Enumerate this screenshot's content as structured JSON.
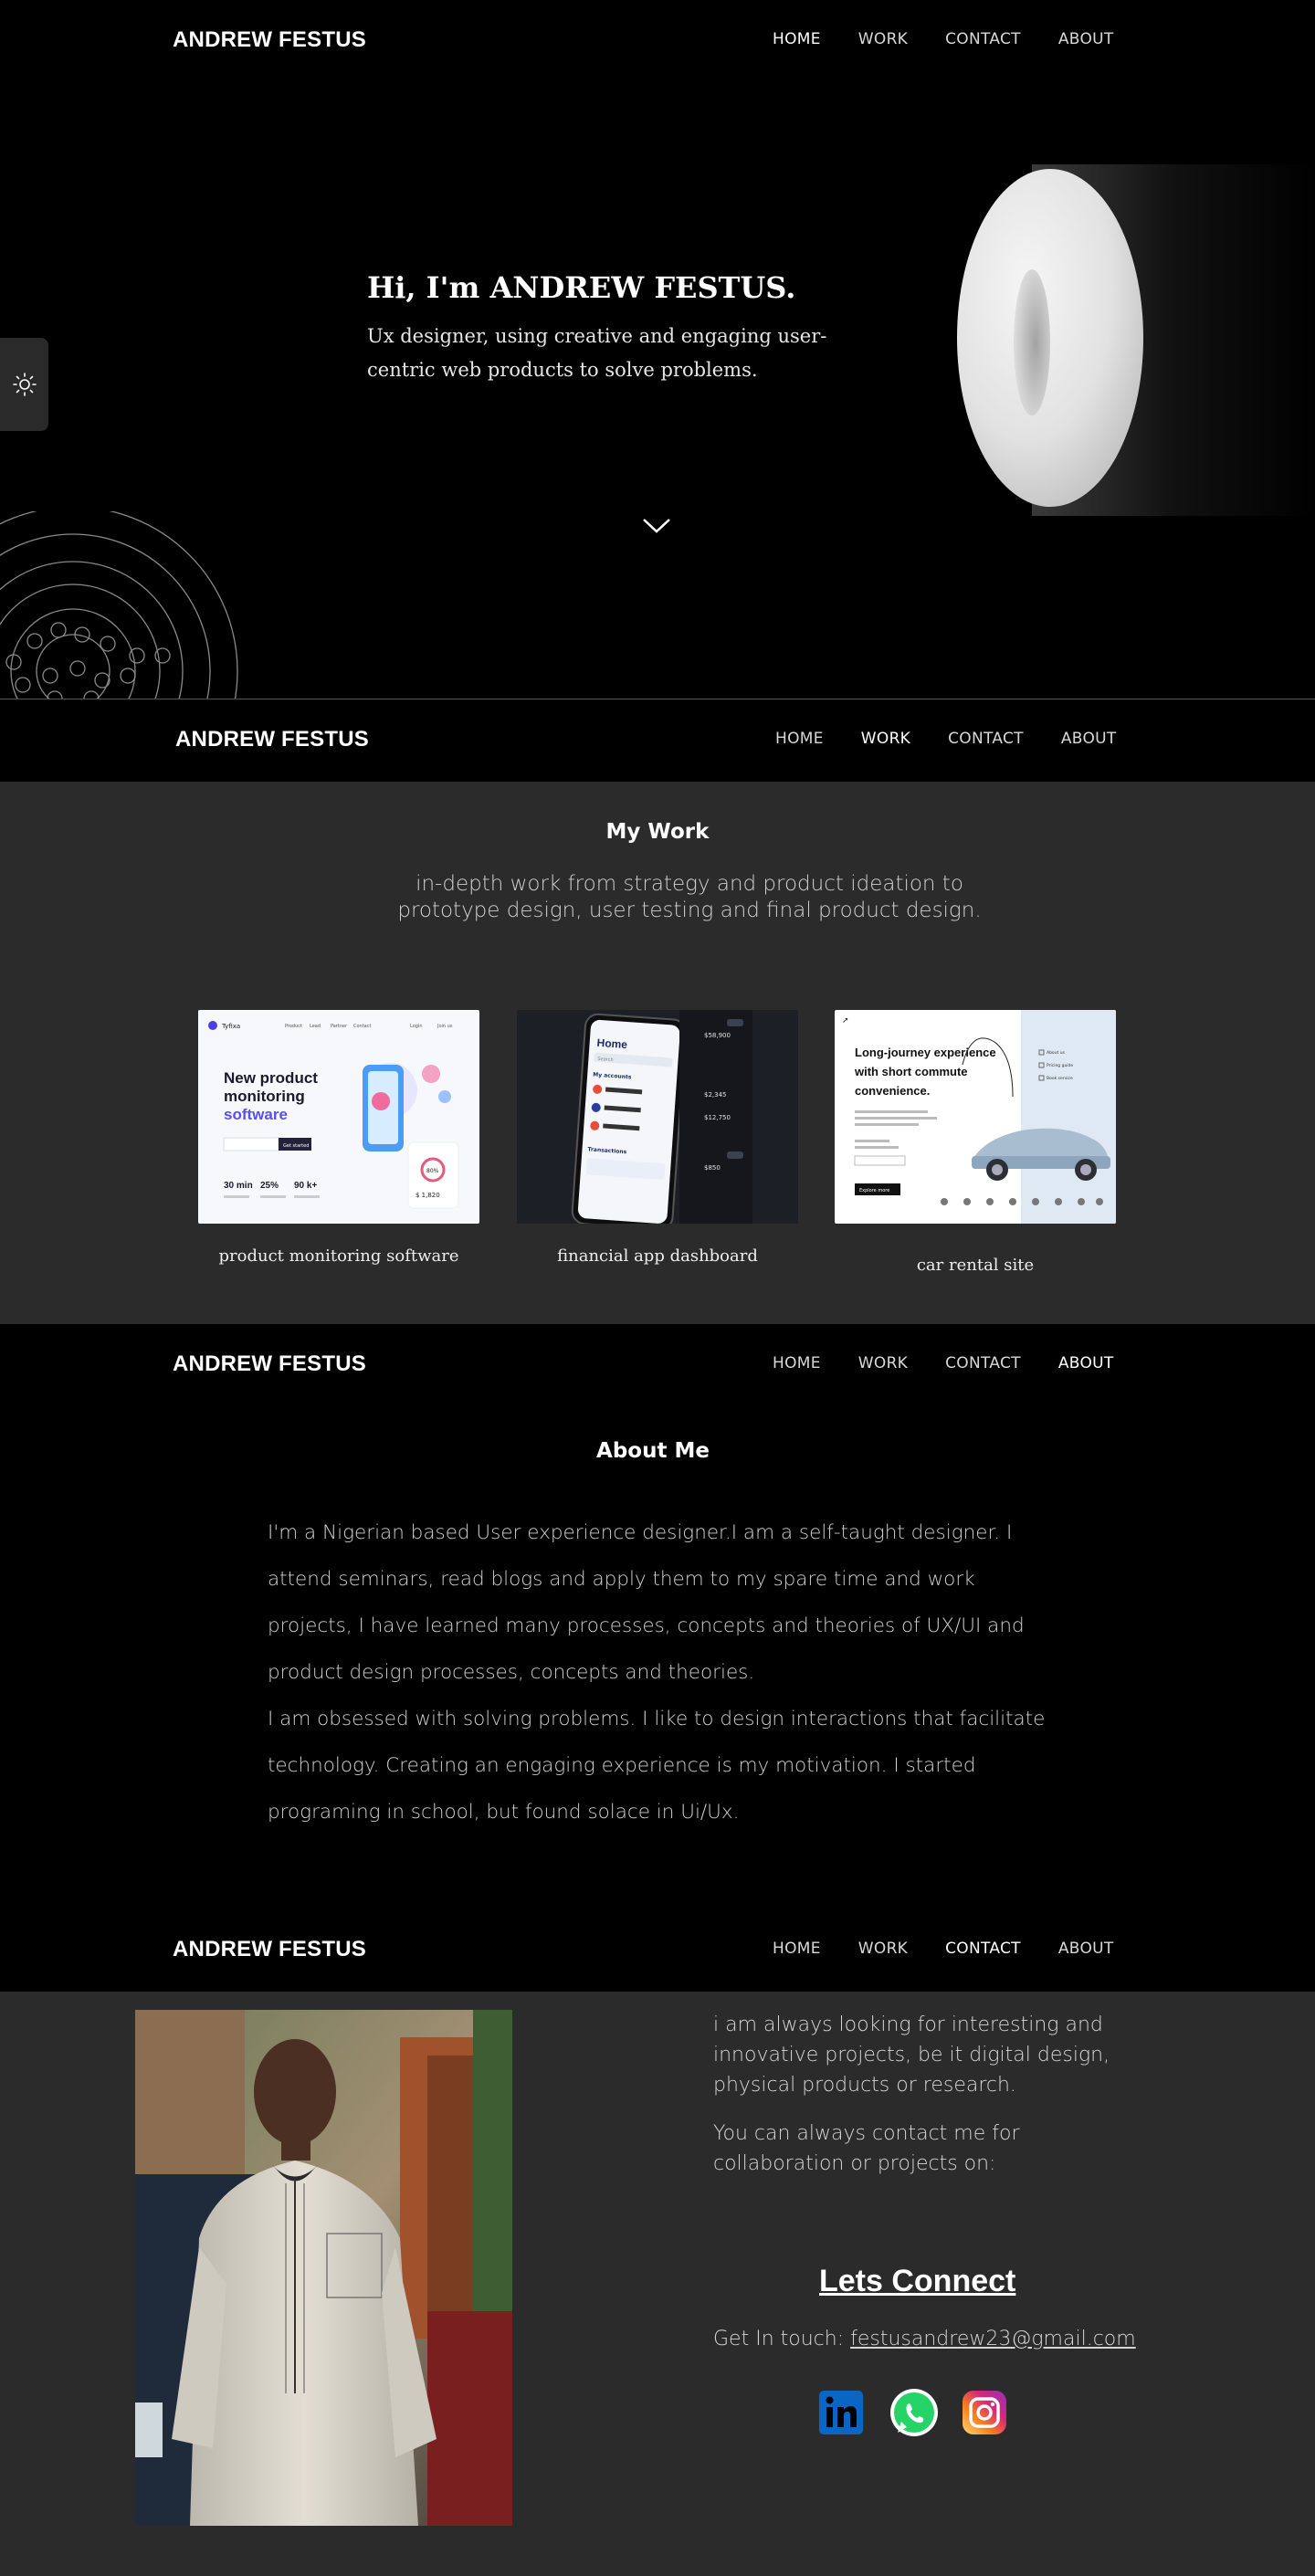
{
  "brand": "ANDREW FESTUS",
  "nav": [
    "HOME",
    "WORK",
    "CONTACT",
    "ABOUT"
  ],
  "hero": {
    "title": "Hi, I'm ANDREW FESTUS.",
    "subtitle": "Ux designer, using creative and engaging user-centric web products to solve problems."
  },
  "work": {
    "title": "My Work",
    "description": "in-depth work from strategy and product ideation to prototype design, user testing and final product design.",
    "projects": [
      {
        "caption": "product monitoring software",
        "mock": {
          "logo": "Tyfixa",
          "links": [
            "Product",
            "Lead",
            "Partner",
            "Contact",
            "Login",
            "Join us"
          ],
          "headline1": "New product",
          "headline2": "monitoring",
          "headline3": "software",
          "cta": "Get started",
          "stats": [
            "30 min",
            "25%",
            "90 k+"
          ],
          "badge": "80%",
          "amount": "$ 1,820"
        }
      },
      {
        "caption": "financial app dashboard",
        "mock": {
          "screen_title": "Home",
          "search": "Search",
          "accounts_label": "My accounts",
          "transactions_label": "Transactions",
          "amounts": [
            "$58,900",
            "$2,345",
            "$12,750",
            "$850"
          ]
        }
      },
      {
        "caption": "car rental site",
        "mock": {
          "headline": "Long-journey experience with short commute convenience.",
          "cta": "Explore more",
          "menu": [
            "About us",
            "Pricing guide",
            "Book service"
          ]
        }
      }
    ]
  },
  "about": {
    "title": "About Me",
    "paragraph1": "I'm a Nigerian based User experience designer.I am a self-taught designer. I attend seminars, read blogs and apply them to my spare time and work projects, I have learned many processes, concepts and theories of UX/UI and product design processes, concepts and theories.",
    "paragraph2": "I am obsessed with solving problems. I like to design interactions that facilitate technology. Creating an engaging experience is my motivation. I started programing in school, but found solace in Ui/Ux."
  },
  "contact": {
    "intro": "i am always looking for interesting and innovative projects, be it digital design, physical products or research.",
    "contact_line": "You can always contact me for collaboration or projects on:",
    "connect_title": "Lets Connect",
    "get_in_touch": "Get In touch:",
    "email": "festusandrew23@gmail.com",
    "socials": [
      "linkedin-icon",
      "whatsapp-icon",
      "instagram-icon"
    ]
  },
  "colors": {
    "background": "#000000",
    "panel": "#2b2b2b",
    "linkedin": "#0a66c2",
    "whatsapp": "#25d366",
    "instagram_start": "#feda75",
    "instagram_end": "#962fbf"
  }
}
